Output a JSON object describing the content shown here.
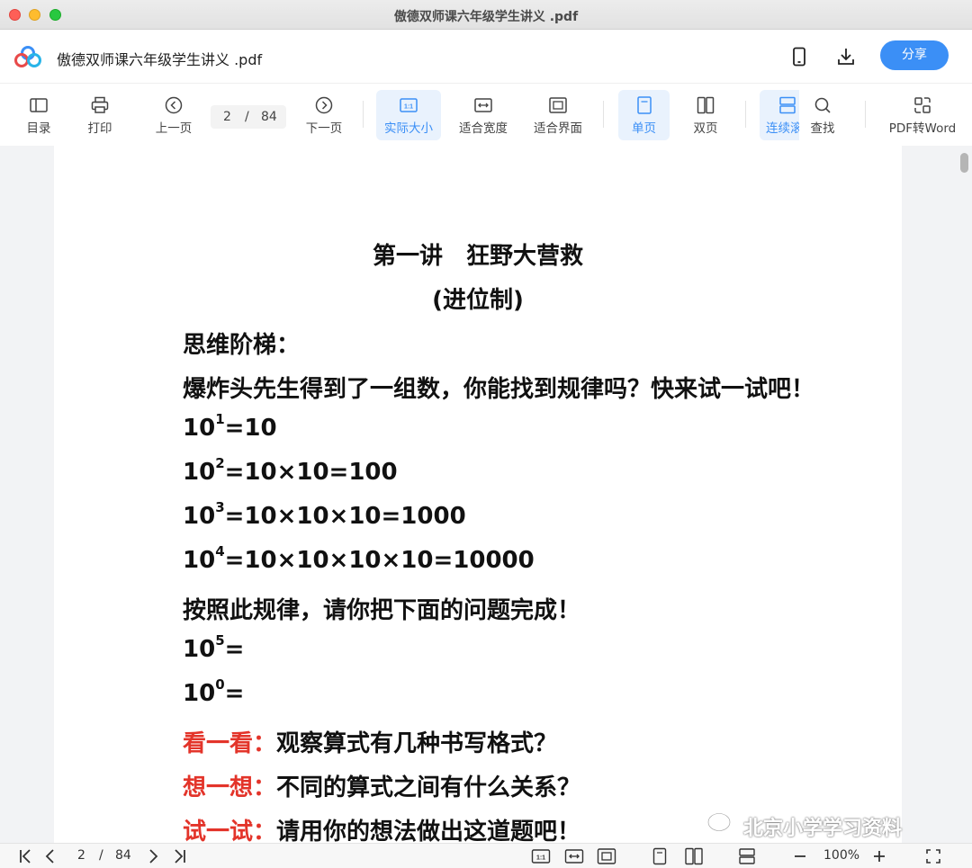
{
  "window": {
    "title": "傲德双师课六年级学生讲义 .pdf"
  },
  "header": {
    "doc_title": "傲德双师课六年级学生讲义 .pdf",
    "share_label": "分享"
  },
  "toolbar": {
    "toc": "目录",
    "print": "打印",
    "prev": "上一页",
    "page_current": "2",
    "page_sep": "/",
    "page_total": "84",
    "next": "下一页",
    "actual_size": "实际大小",
    "fit_width": "适合宽度",
    "fit_page": "适合界面",
    "single": "单页",
    "double": "双页",
    "continuous": "连续滚",
    "find": "查找",
    "pdf_to_word": "PDF转Word"
  },
  "document": {
    "title": "第一讲　狂野大营救",
    "subtitle": "(进位制)",
    "section": "思维阶梯：",
    "intro": "爆炸头先生得到了一组数，你能找到规律吗？快来试一试吧！",
    "eq1": {
      "base": "10",
      "exp": "1",
      "rest": "=10"
    },
    "eq2": {
      "base": "10",
      "exp": "2",
      "rest": "=10×10=100"
    },
    "eq3": {
      "base": "10",
      "exp": "3",
      "rest": "=10×10×10=1000"
    },
    "eq4": {
      "base": "10",
      "exp": "4",
      "rest": "=10×10×10×10=10000"
    },
    "instruction": "按照此规律，请你把下面的问题完成！",
    "q1": {
      "base": "10",
      "exp": "5",
      "rest": "="
    },
    "q2": {
      "base": "10",
      "exp": "0",
      "rest": "="
    },
    "look_label": "看一看：",
    "look_text": "观察算式有几种书写格式？",
    "think_label": "想一想：",
    "think_text": "不同的算式之间有什么关系？",
    "try_label": "试一试：",
    "try_text": "请用你的想法做出这道题吧！"
  },
  "bottombar": {
    "page_current": "2",
    "page_sep": "/",
    "page_total": "84",
    "zoom": "100%"
  },
  "watermark": {
    "text": "北京小学学习资料"
  },
  "colors": {
    "accent": "#3b8ff6",
    "highlight_red": "#e3342a"
  }
}
